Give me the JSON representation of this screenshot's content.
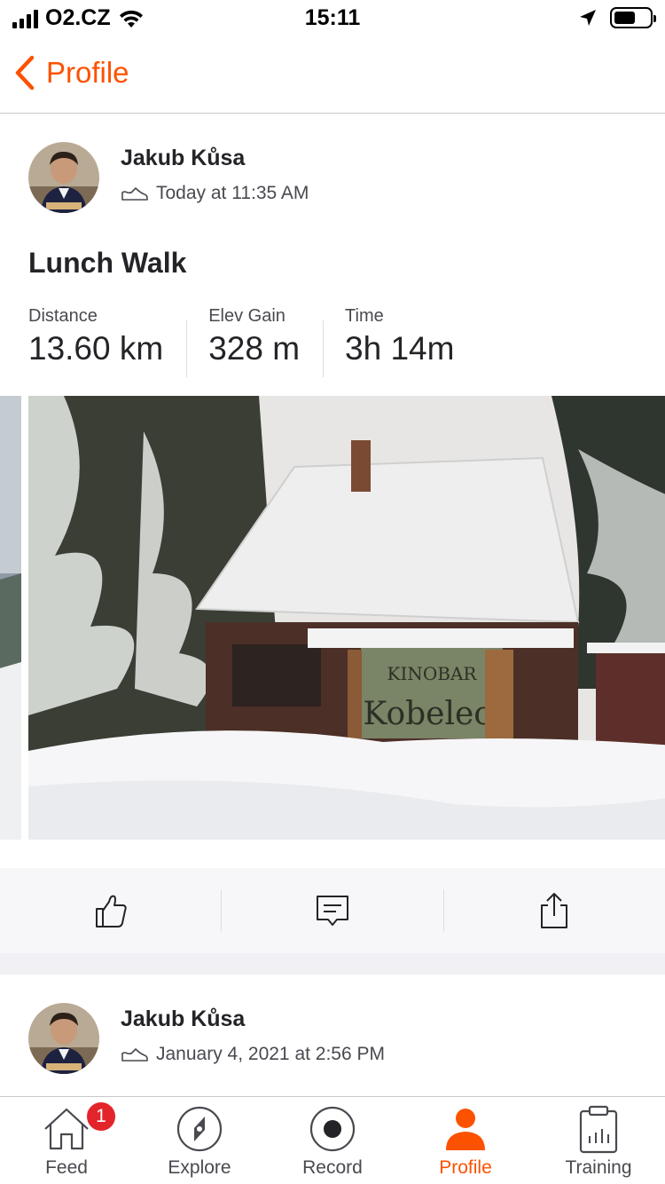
{
  "status_bar": {
    "carrier": "O2.CZ",
    "time": "15:11"
  },
  "nav": {
    "back_label": "Profile",
    "accent_color": "#fc5200"
  },
  "activities": [
    {
      "athlete_name": "Jakub Kůsa",
      "timestamp": "Today at 11:35 AM",
      "title": "Lunch Walk",
      "stats": [
        {
          "label": "Distance",
          "value": "13.60 km"
        },
        {
          "label": "Elev Gain",
          "value": "328 m"
        },
        {
          "label": "Time",
          "value": "3h 14m"
        }
      ],
      "photo_sign_text": [
        "KINOBAR",
        "Kobelec"
      ]
    },
    {
      "athlete_name": "Jakub Kůsa",
      "timestamp": "January 4, 2021 at 2:56 PM"
    }
  ],
  "actions": [
    "thumbs-up-icon",
    "comment-icon",
    "share-icon"
  ],
  "tabs": [
    {
      "label": "Feed",
      "icon": "home-icon",
      "badge": "1"
    },
    {
      "label": "Explore",
      "icon": "compass-icon"
    },
    {
      "label": "Record",
      "icon": "record-icon"
    },
    {
      "label": "Profile",
      "icon": "person-icon",
      "active": true
    },
    {
      "label": "Training",
      "icon": "clipboard-chart-icon"
    }
  ]
}
